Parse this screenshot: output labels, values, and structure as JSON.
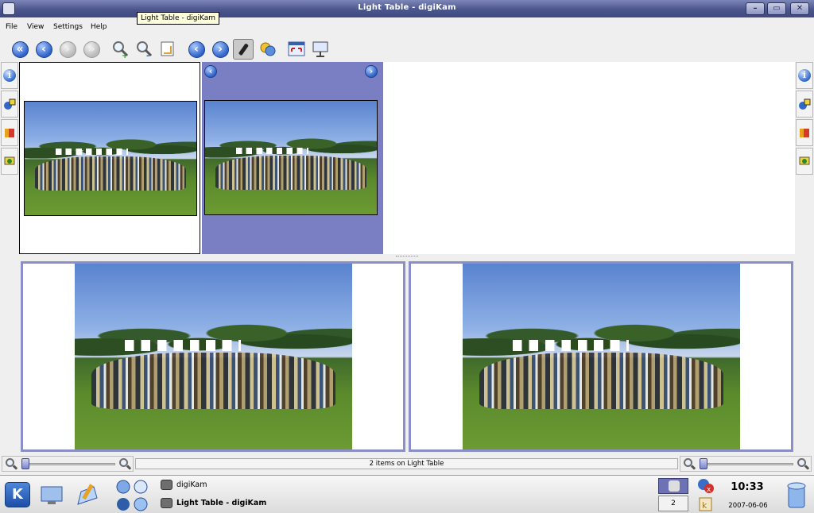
{
  "window": {
    "title": "Light Table - digiKam"
  },
  "tooltip": "Light Table - digiKam",
  "menu": [
    {
      "label": "File"
    },
    {
      "label": "View"
    },
    {
      "label": "Settings"
    },
    {
      "label": "Help"
    }
  ],
  "toolbar_icons": [
    "first-icon",
    "back-icon",
    "forward-icon",
    "last-icon",
    "zoom-in-icon",
    "zoom-out-icon",
    "fit-icon",
    "previous-icon",
    "next-icon",
    "sync-icon",
    "compare-icon",
    "fullscreen-icon",
    "slideshow-icon"
  ],
  "status": {
    "message": "2 items on Light Table"
  },
  "taskbar": {
    "tasks": [
      {
        "label": "digiKam"
      },
      {
        "label": "Light Table - digiKam"
      }
    ],
    "desktop_number": "2",
    "clock": "10:33",
    "date": "2007-06-06"
  },
  "colors": {
    "titlebar": "#4b568d",
    "selection": "#7a7ec2",
    "preview_border": "#8a8fc8"
  }
}
